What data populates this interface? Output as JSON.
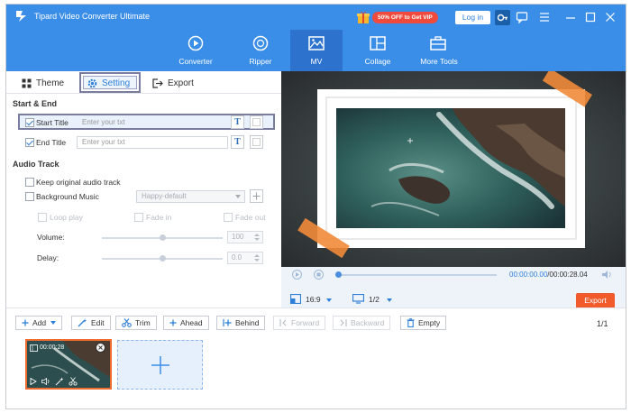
{
  "app": {
    "title": "Tipard Video Converter Ultimate",
    "vip_badge": "50% OFF to Get VIP",
    "login_label": "Log in"
  },
  "nav": [
    {
      "label": "Converter",
      "icon": "converter-icon"
    },
    {
      "label": "Ripper",
      "icon": "disc-icon"
    },
    {
      "label": "MV",
      "icon": "image-icon",
      "active": true
    },
    {
      "label": "Collage",
      "icon": "collage-icon"
    },
    {
      "label": "More Tools",
      "icon": "toolbox-icon"
    }
  ],
  "tabs": {
    "theme": "Theme",
    "setting": "Setting",
    "export": "Export"
  },
  "start_end": {
    "heading": "Start & End",
    "start_title": {
      "label": "Start Title",
      "placeholder": "Enter your txt",
      "checked": true
    },
    "end_title": {
      "label": "End Title",
      "placeholder": "Enter your txt",
      "checked": true
    },
    "text_button": "T"
  },
  "audio": {
    "heading": "Audio Track",
    "keep_original": "Keep original audio track",
    "background_music": "Background Music",
    "music_selected": "Happy-default",
    "loop_play": "Loop play",
    "fade_in": "Fade in",
    "fade_out": "Fade out",
    "volume_label": "Volume:",
    "volume_value": "100",
    "delay_label": "Delay:",
    "delay_value": "0.0"
  },
  "player": {
    "current_time": "00:00:00.00",
    "total_time": "/00:00:28.04",
    "aspect_ratio": "16:9",
    "page": "1/2",
    "export_label": "Export"
  },
  "toolbar": {
    "add": "Add",
    "edit": "Edit",
    "trim": "Trim",
    "ahead": "Ahead",
    "behind": "Behind",
    "forward": "Forward",
    "backward": "Backward",
    "empty": "Empty",
    "page_count": "1/1"
  },
  "clip": {
    "duration": "00:00:28"
  },
  "colors": {
    "brand_blue": "#3a8ee8",
    "nav_active": "#2d72cc",
    "accent": "#2d7fd9",
    "export_orange": "#f15a2b",
    "vip_red": "#ef4a3c"
  }
}
